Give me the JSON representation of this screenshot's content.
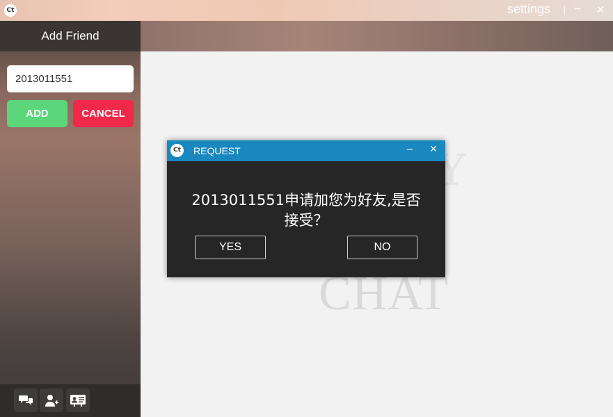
{
  "app": {
    "logo_text": "Ct",
    "settings_label": "settings",
    "minimize_glyph": "−",
    "close_glyph": "✕"
  },
  "sidebar": {
    "title": "Add Friend",
    "friend_id_value": "2013011551",
    "add_label": "ADD",
    "cancel_label": "CANCEL",
    "footer_icons": [
      "chat-bubbles-icon",
      "add-user-icon",
      "contact-card-icon"
    ]
  },
  "watermark": {
    "line1": "Y",
    "line2": "CHAT"
  },
  "dialog": {
    "logo_text": "Ct",
    "title": "REQUEST",
    "message": "2013011551申请加您为好友,是否接受？",
    "yes_label": "YES",
    "no_label": "NO"
  },
  "colors": {
    "add_green": "#5cd67a",
    "cancel_red": "#f0284a",
    "dialog_titlebar_blue": "#1888bf",
    "dialog_body": "#262626"
  }
}
